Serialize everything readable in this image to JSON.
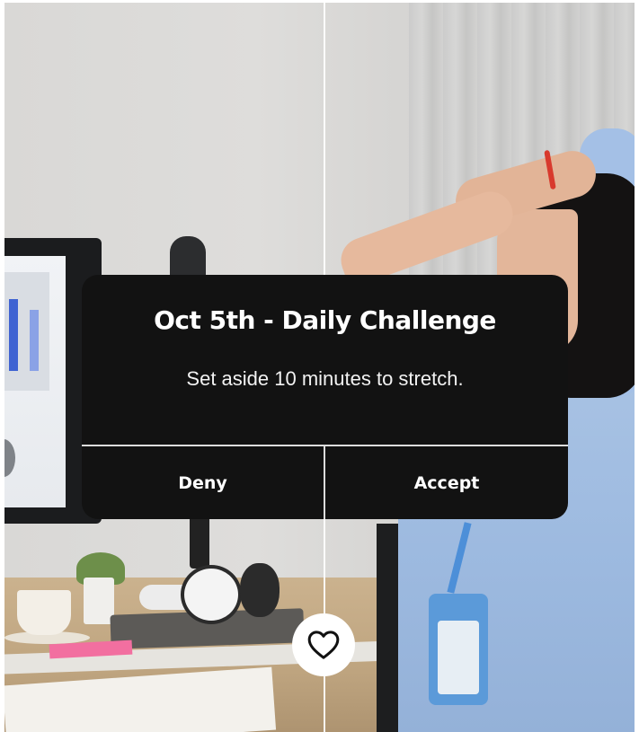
{
  "dialog": {
    "title": "Oct 5th - Daily Challenge",
    "message": "Set aside 10 minutes to stretch.",
    "deny_label": "Deny",
    "accept_label": "Accept",
    "background_color": "#121212",
    "text_color": "#ffffff"
  },
  "actions": {
    "favorite_icon": "heart-icon"
  },
  "background": {
    "description_icon": "photo-background"
  }
}
